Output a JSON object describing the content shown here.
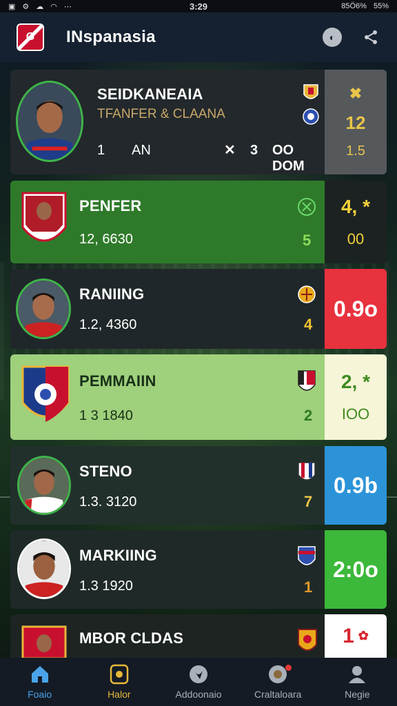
{
  "status_bar": {
    "time": "3:29",
    "left_icons": [
      "image-icon",
      "settings-icon",
      "cloud-icon",
      "wifi-icon",
      "more-icon"
    ],
    "right_text": "85Ö6%",
    "battery_text": "55%"
  },
  "header": {
    "title": "INspanasia",
    "logo_text": "G",
    "actions": [
      "compass-icon",
      "share-icon"
    ]
  },
  "cards": [
    {
      "name": "SEIDKANEAIA",
      "subtitle": "TFANFER & CLAANA",
      "stat_1": "1",
      "stat_2": "AN",
      "stat_3": "3",
      "stat_4": "OO DOM",
      "side_top": "12",
      "side_bottom": "1.5",
      "side_icon": "close-icon",
      "colors": {
        "bg": "#22282b",
        "side": "#55595c",
        "side_text": "#e8c44a",
        "subtitle": "#c9a86a"
      }
    },
    {
      "name": "PENFER",
      "subtitle": "12, 6630",
      "score": "5",
      "side_top": "4, *",
      "side_bottom": "00",
      "colors": {
        "bg": "#2f7a2a",
        "side": "#1c2221",
        "side_text": "#f2d13a",
        "score": "#8edc5a"
      }
    },
    {
      "name": "RANIING",
      "subtitle": "1.2, 4360",
      "score": "4",
      "side_top": "0.9o",
      "colors": {
        "bg": "#20272a",
        "side": "#e8323e",
        "side_text": "#ffffff",
        "score": "#f2c032"
      }
    },
    {
      "name": "PEMMAIIN",
      "subtitle": "1 3  1840",
      "score": "2",
      "side_top": "2, *",
      "side_bottom": "IOO",
      "colors": {
        "bg": "#9fd07c",
        "side": "#f6f5d8",
        "side_text": "#3e8a1e",
        "text": "#183018",
        "score": "#2c7a22"
      }
    },
    {
      "name": "STENO",
      "subtitle": "1.3.  3120",
      "score": "7",
      "side_top": "0.9b",
      "colors": {
        "bg": "#22302c",
        "side": "#2c93d8",
        "side_text": "#ffffff",
        "score": "#e8c44a"
      }
    },
    {
      "name": "MARKIING",
      "subtitle": "1.3  1920",
      "score": "1",
      "side_top": "2:0o",
      "colors": {
        "bg": "#1f2a28",
        "side": "#3cb83a",
        "side_text": "#ffffff",
        "score": "#e09a2a"
      }
    },
    {
      "name": "MBOR CLDAS",
      "side_top": "1",
      "side_icon": "medal-icon",
      "colors": {
        "bg": "#1d2422",
        "side": "#ffffff",
        "side_text": "#d8262e"
      }
    }
  ],
  "nav": [
    {
      "label": "Foaio",
      "icon": "home-icon"
    },
    {
      "label": "Halor",
      "icon": "shield-icon"
    },
    {
      "label": "Addoonaio",
      "icon": "twitter-icon"
    },
    {
      "label": "Craltaloara",
      "icon": "ball-icon"
    },
    {
      "label": "Negie",
      "icon": "profile-icon"
    }
  ]
}
